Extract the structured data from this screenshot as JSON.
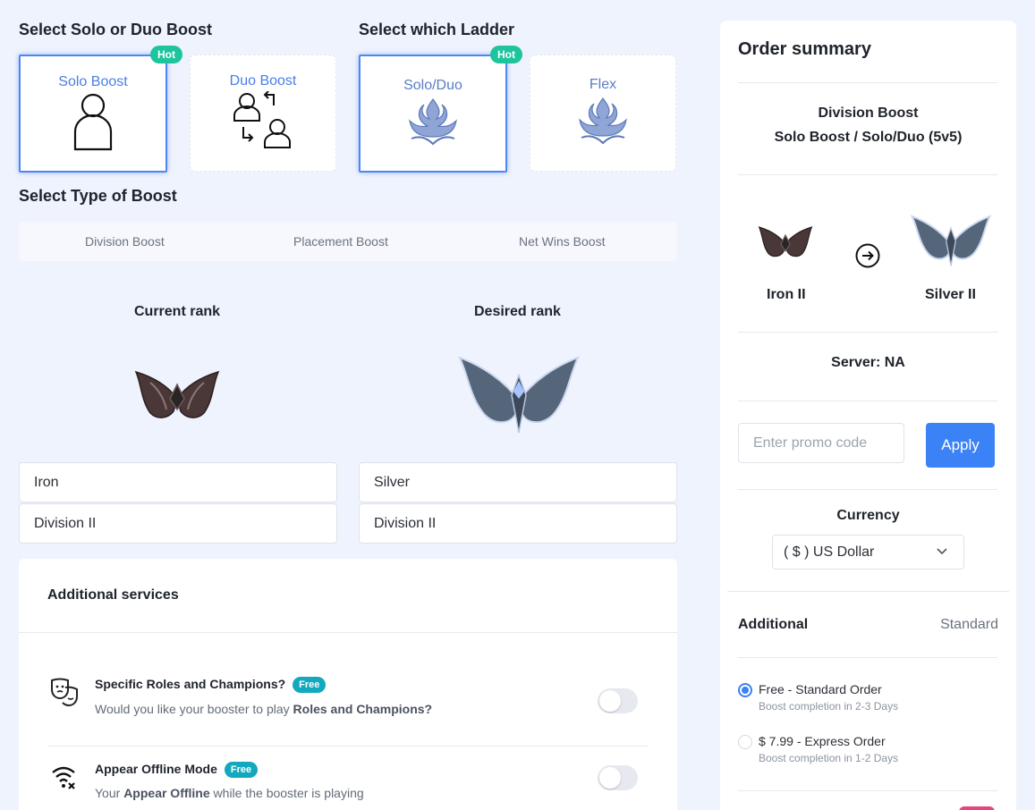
{
  "boost_mode": {
    "title": "Select Solo or Duo Boost",
    "options": [
      {
        "label": "Solo Boost",
        "badge": "Hot",
        "selected": true,
        "icon": "person-icon"
      },
      {
        "label": "Duo Boost",
        "selected": false,
        "icon": "people-swap-icon"
      }
    ]
  },
  "ladder": {
    "title": "Select which Ladder",
    "options": [
      {
        "label": "Solo/Duo",
        "badge": "Hot",
        "selected": true,
        "icon": "ladder-emblem-icon"
      },
      {
        "label": "Flex",
        "selected": false,
        "icon": "ladder-emblem-icon"
      }
    ]
  },
  "boost_type": {
    "title": "Select Type of Boost",
    "tabs": [
      "Division Boost",
      "Placement Boost",
      "Net Wins Boost"
    ],
    "selected": "Division Boost"
  },
  "current_rank": {
    "heading": "Current rank",
    "tier": "Iron",
    "division": "Division II",
    "emblem": "iron-emblem"
  },
  "desired_rank": {
    "heading": "Desired rank",
    "tier": "Silver",
    "division": "Division II",
    "emblem": "silver-emblem"
  },
  "additional_services": {
    "title": "Additional services",
    "items": [
      {
        "title": "Specific Roles and Champions?",
        "badge": "Free",
        "desc_prefix": "Would you like your booster to play ",
        "desc_bold": "Roles and Champions?",
        "desc_suffix": "",
        "enabled": false,
        "icon": "masks-icon"
      },
      {
        "title": "Appear Offline Mode",
        "badge": "Free",
        "desc_prefix": "Your ",
        "desc_bold": "Appear Offline",
        "desc_suffix": " while the booster is playing",
        "enabled": false,
        "icon": "wifi-off-icon"
      }
    ]
  },
  "summary": {
    "title": "Order summary",
    "boost_name": "Division Boost",
    "boost_detail": "Solo Boost / Solo/Duo (5v5)",
    "from_rank": "Iron II",
    "to_rank": "Silver II",
    "server": "Server: NA",
    "promo_placeholder": "Enter promo code",
    "apply_label": "Apply",
    "currency_label": "Currency",
    "currency_value": "( $ ) US Dollar",
    "additional_label": "Additional",
    "additional_value": "Standard",
    "delivery_options": [
      {
        "label": "Free - Standard Order",
        "sub": "Boost completion in 2-3 Days",
        "selected": true
      },
      {
        "label": "$ 7.99 - Express Order",
        "sub": "Boost completion in 1-2 Days",
        "selected": false
      }
    ]
  },
  "colors": {
    "accent": "#3b82f6",
    "hot_badge": "#1ec49c",
    "free_badge": "#12a9bf",
    "background": "#eff3fd"
  }
}
